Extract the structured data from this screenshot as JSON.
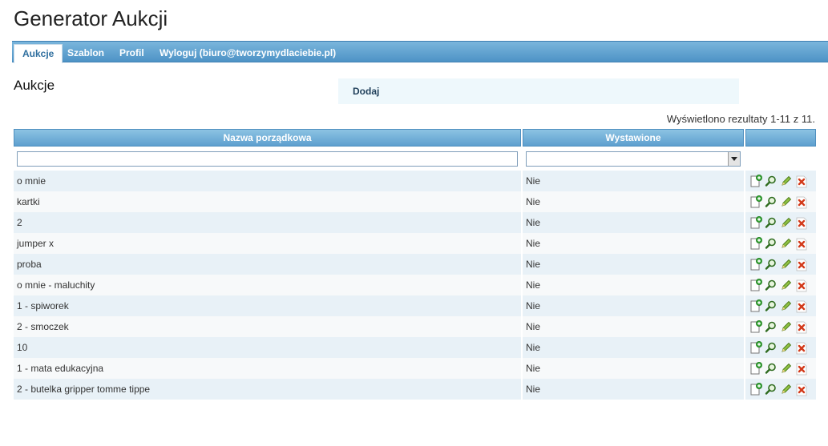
{
  "app": {
    "title": "Generator Aukcji"
  },
  "nav": [
    {
      "label": "Aukcje",
      "active": true
    },
    {
      "label": "Szablon"
    },
    {
      "label": "Profil"
    },
    {
      "label": "Wyloguj (biuro@tworzymydlaciebie.pl)"
    }
  ],
  "page": {
    "title": "Aukcje",
    "add_label": "Dodaj",
    "results_text": "Wyświetlono rezultaty 1-11 z 11."
  },
  "table": {
    "columns": [
      "Nazwa porządkowa",
      "Wystawione",
      ""
    ],
    "filter": {
      "name_value": "",
      "selected_value": ""
    },
    "rows": [
      {
        "name": "o mnie",
        "status": "Nie"
      },
      {
        "name": "kartki",
        "status": "Nie"
      },
      {
        "name": "2",
        "status": "Nie"
      },
      {
        "name": "jumper x",
        "status": "Nie"
      },
      {
        "name": "proba",
        "status": "Nie"
      },
      {
        "name": "o mnie - maluchity",
        "status": "Nie"
      },
      {
        "name": "1 - spiworek",
        "status": "Nie"
      },
      {
        "name": "2 - smoczek",
        "status": "Nie"
      },
      {
        "name": "10",
        "status": "Nie"
      },
      {
        "name": "1 - mata edukacyjna",
        "status": "Nie"
      },
      {
        "name": "2 - butelka gripper tomme tippe",
        "status": "Nie"
      }
    ]
  },
  "icons": {
    "row_actions": [
      "add-document-icon",
      "search-icon",
      "edit-pencil-icon",
      "delete-icon"
    ]
  },
  "colors": {
    "nav_gradient_top": "#7ab6dc",
    "nav_gradient_bottom": "#4e93c6",
    "row_odd": "#e8f1f7",
    "row_even": "#f7f9fa",
    "action_box": "#eef8fc"
  }
}
